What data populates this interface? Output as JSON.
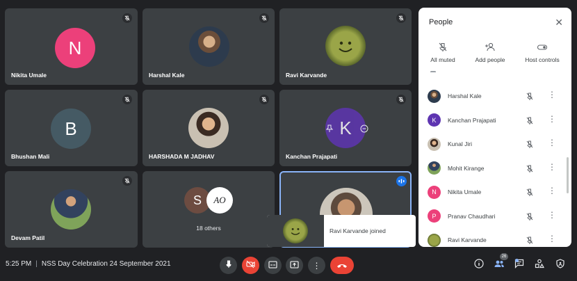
{
  "tiles": {
    "nikita": {
      "name": "Nikita Umale",
      "initial": "N",
      "color": "#ec407a"
    },
    "harshal": {
      "name": "Harshal Kale"
    },
    "ravi": {
      "name": "Ravi Karvande"
    },
    "bhushan": {
      "name": "Bhushan Mali",
      "initial": "B",
      "color": "#455a64"
    },
    "harshada": {
      "name": "HARSHADA M JADHAV"
    },
    "kanchan": {
      "name": "Kanchan Prajapati",
      "initial": "K",
      "color": "#5e35b1"
    },
    "devam": {
      "name": "Devam Patil"
    },
    "others": {
      "label": "18 others",
      "initial": "S",
      "logo": "AO"
    }
  },
  "panel": {
    "title": "People",
    "actions": {
      "all_muted": "All muted",
      "add_people": "Add people",
      "host_controls": "Host controls"
    },
    "people": [
      {
        "name": "Harshal Kale",
        "avatar": "photo"
      },
      {
        "name": "Kanchan Prajapati",
        "initial": "K",
        "color": "#5e35b1"
      },
      {
        "name": "Kunal Jiri",
        "avatar": "photo"
      },
      {
        "name": "Mohit Kirange",
        "avatar": "photo"
      },
      {
        "name": "Nikita Umale",
        "initial": "N",
        "color": "#ec407a"
      },
      {
        "name": "Pranav Chaudhari",
        "initial": "P",
        "color": "#ec407a"
      },
      {
        "name": "Ravi Karvande",
        "avatar": "smiley"
      }
    ]
  },
  "toast": {
    "text": "Ravi Karvande joined"
  },
  "bottom": {
    "time": "5:25 PM",
    "meeting_title": "NSS Day Celebration 24 September 2021",
    "participants_count": "26"
  },
  "colors": {
    "accent": "#8ab4f8",
    "danger": "#ea4335",
    "tile": "#3c4043"
  }
}
